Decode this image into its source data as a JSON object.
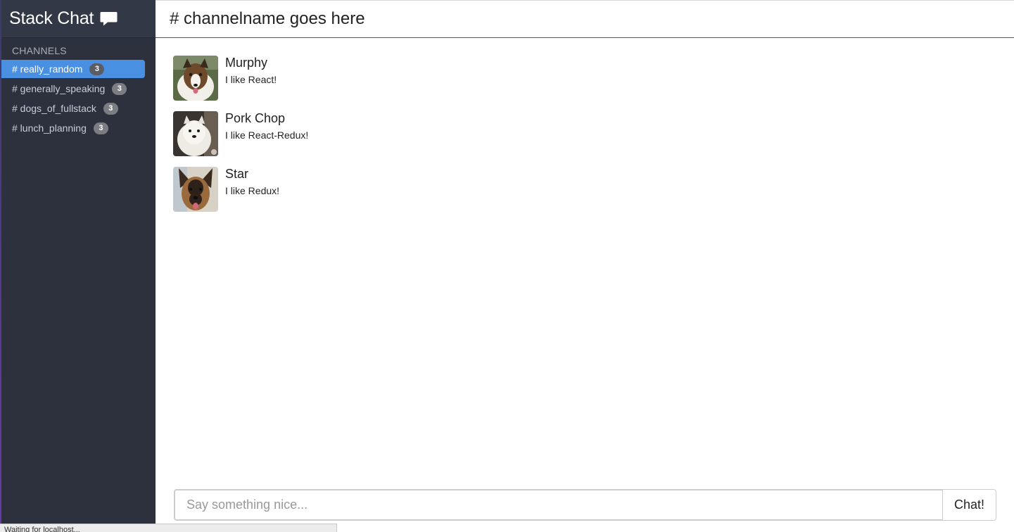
{
  "app": {
    "name": "Stack Chat",
    "icon": "speech-bubble-icon"
  },
  "sidebar": {
    "section_label": "CHANNELS",
    "channels": [
      {
        "label": "# really_random",
        "count": "3",
        "active": true
      },
      {
        "label": "# generally_speaking",
        "count": "3",
        "active": false
      },
      {
        "label": "# dogs_of_fullstack",
        "count": "3",
        "active": false
      },
      {
        "label": "# lunch_planning",
        "count": "3",
        "active": false
      }
    ]
  },
  "main": {
    "channel_title": "# channelname goes here",
    "messages": [
      {
        "author": "Murphy",
        "text": "I like React!",
        "avatar": "sheltie-dog-avatar"
      },
      {
        "author": "Pork Chop",
        "text": "I like React-Redux!",
        "avatar": "westie-dog-avatar"
      },
      {
        "author": "Star",
        "text": "I like Redux!",
        "avatar": "german-shepherd-avatar"
      }
    ]
  },
  "composer": {
    "placeholder": "Say something nice...",
    "value": "",
    "send_label": "Chat!"
  },
  "status_bar": {
    "text": "Waiting for localhost..."
  },
  "colors": {
    "sidebar_bg": "#2c313d",
    "active_channel": "#4a90e2",
    "badge": "#7a7d82"
  }
}
